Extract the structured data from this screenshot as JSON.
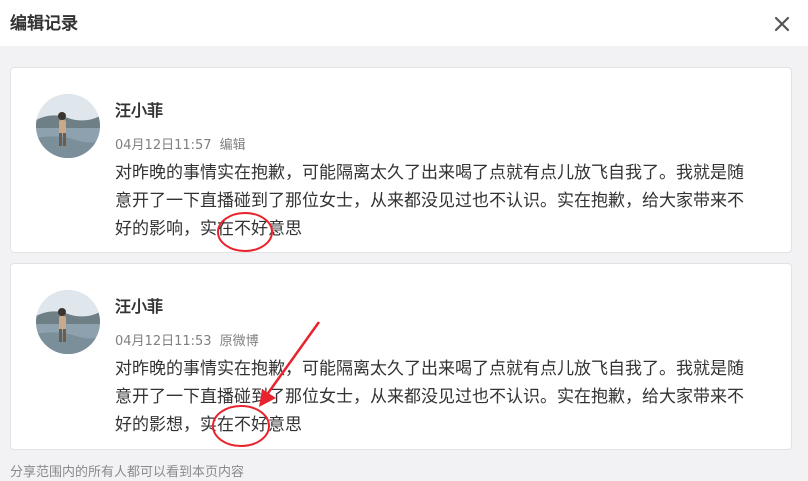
{
  "dialog": {
    "title": "编辑记录"
  },
  "records": [
    {
      "username": "汪小菲",
      "time": "04月12日11:57",
      "source": "编辑",
      "content": "对昨晚的事情实在抱歉，可能隔离太久了出来喝了点就有点儿放飞自我了。我就是随意开了一下直播碰到了那位女士，从来都没见过也不认识。实在抱歉，给大家带来不好的影响，实在不好意思"
    },
    {
      "username": "汪小菲",
      "time": "04月12日11:53",
      "source": "原微博",
      "content": "对昨晚的事情实在抱歉，可能隔离太久了出来喝了点就有点儿放飞自我了。我就是随意开了一下直播碰到了那位女士，从来都没见过也不认识。实在抱歉，给大家带来不好的影想，实在不好意思"
    }
  ],
  "footer": {
    "note": "分享范围内的所有人都可以看到本页内容"
  },
  "icons": {
    "close": "close-icon",
    "avatar": "user-avatar-photo"
  },
  "colors": {
    "annotation": "#e8232d",
    "meta_text": "#808080",
    "background": "#f2f2f5"
  }
}
